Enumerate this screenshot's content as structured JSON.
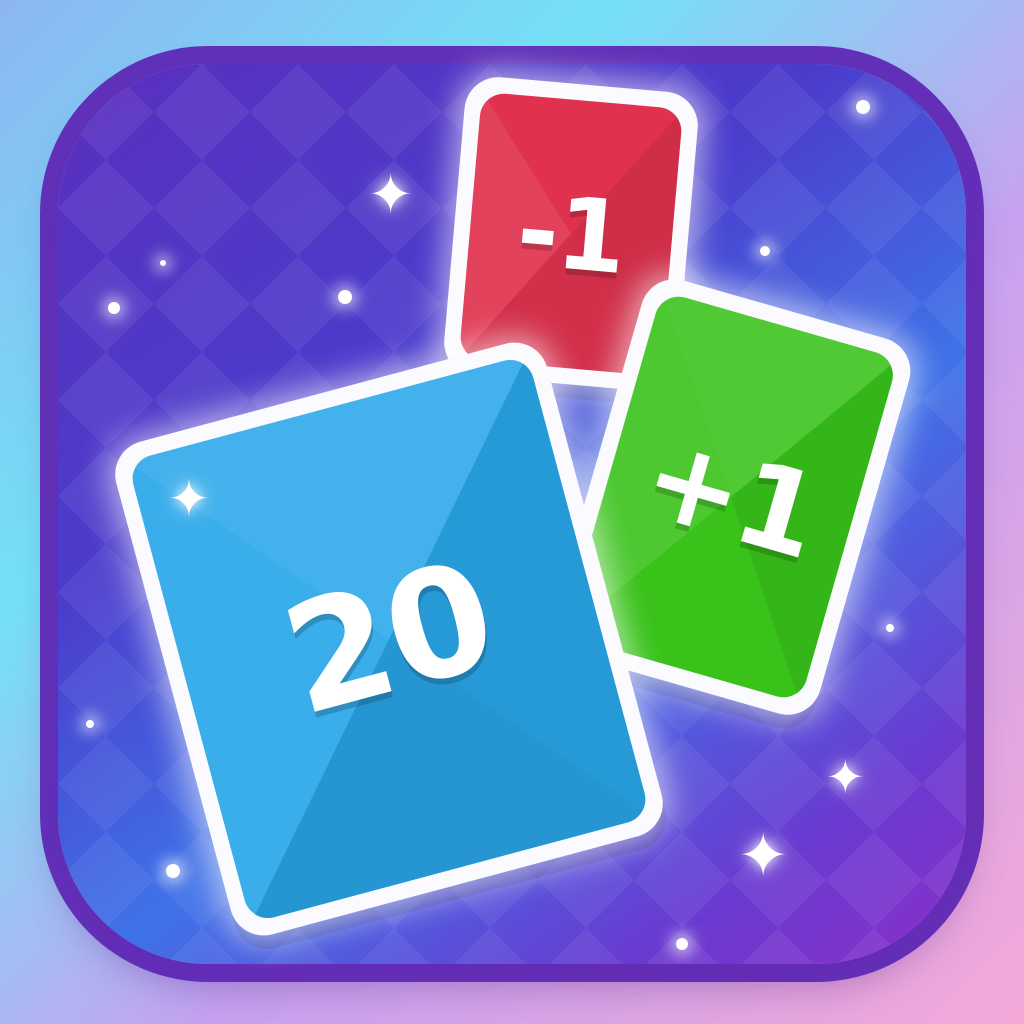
{
  "app_icon": {
    "cards": {
      "red": {
        "label": "-1",
        "color": "#e0324f"
      },
      "green": {
        "label": "+1",
        "color": "#39c21a"
      },
      "blue": {
        "label": "20",
        "color": "#2aa8ea"
      }
    },
    "colors": {
      "tile_purple": "#5a2fbe",
      "tile_blue": "#3f72e8",
      "card_border": "#fbfbff"
    },
    "decorations": [
      "sparkle-icon",
      "glow-dot"
    ]
  }
}
